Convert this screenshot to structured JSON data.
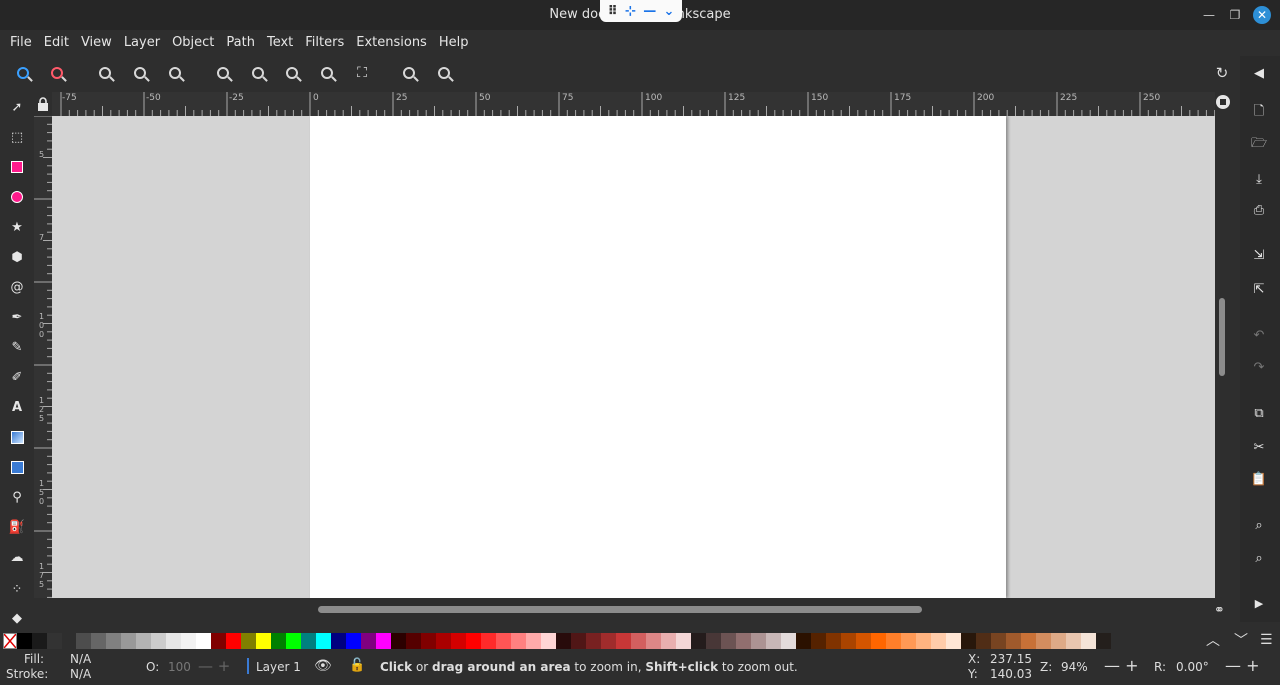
{
  "window": {
    "title": "New document 1 - Inkscape"
  },
  "menu": [
    "File",
    "Edit",
    "View",
    "Layer",
    "Object",
    "Path",
    "Text",
    "Filters",
    "Extensions",
    "Help"
  ],
  "zoombar": {
    "icons": [
      "zoom-in-icon",
      "zoom-out-icon",
      "zoom-1-1-icon",
      "zoom-1-2-icon",
      "zoom-2-1-icon",
      "zoom-selection-icon",
      "zoom-drawing-icon",
      "zoom-page-icon",
      "zoom-page-width-icon",
      "zoom-center-page-icon",
      "zoom-previous-icon",
      "zoom-next-icon"
    ]
  },
  "tools": [
    "selector-icon",
    "node-tool-icon",
    "rectangle-tool-icon",
    "ellipse-tool-icon",
    "star-tool-icon",
    "3dbox-tool-icon",
    "spiral-tool-icon",
    "pen-tool-icon",
    "pencil-tool-icon",
    "calligraphy-tool-icon",
    "text-tool-icon",
    "gradient-tool-icon",
    "mesh-tool-icon",
    "dropper-tool-icon",
    "paint-bucket-icon",
    "tweak-tool-icon",
    "spray-tool-icon",
    "eraser-tool-icon"
  ],
  "ruler": {
    "h_labels": [
      "-75",
      "-50",
      "-25",
      "0",
      "25",
      "50",
      "75",
      "100",
      "125",
      "150",
      "175",
      "200",
      "225",
      "250"
    ],
    "v_labels": [
      "5",
      "7",
      "1 0 0",
      "1 2 5",
      "1 5 0",
      "1 7 5"
    ]
  },
  "palette": {
    "colors": [
      "#000000",
      "#1a1a1a",
      "#333333",
      "#4d4d4d",
      "#666666",
      "#808080",
      "#999999",
      "#b3b3b3",
      "#cccccc",
      "#e6e6e6",
      "#f2f2f2",
      "#ffffff",
      "#800000",
      "#ff0000",
      "#808000",
      "#ffff00",
      "#008000",
      "#00ff00",
      "#008080",
      "#00ffff",
      "#000080",
      "#0000ff",
      "#800080",
      "#ff00ff",
      "#2b0000",
      "#550000",
      "#800000",
      "#aa0000",
      "#d40000",
      "#ff0000",
      "#ff2a2a",
      "#ff5555",
      "#ff8080",
      "#ffaaaa",
      "#ffd5d5",
      "#280b0b",
      "#501616",
      "#782121",
      "#a02c2c",
      "#c83737",
      "#d35f5f",
      "#de8787",
      "#e9afaf",
      "#f4d7d7",
      "#241c1c",
      "#483737",
      "#6c5353",
      "#916f6f",
      "#ac9393",
      "#c8b7b7",
      "#e3dbdb",
      "#2b1100",
      "#552200",
      "#803300",
      "#aa4400",
      "#d45500",
      "#ff6600",
      "#ff7f2a",
      "#ff9955",
      "#ffb380",
      "#ffccaa",
      "#ffe6d5",
      "#28170b",
      "#502d16",
      "#784421",
      "#a05a2c",
      "#c87137",
      "#d38d5f",
      "#deaa87",
      "#e9c6af",
      "#f4e3d7",
      "#241f1c"
    ]
  },
  "status": {
    "fill_label": "Fill:",
    "fill_value": "N/A",
    "stroke_label": "Stroke:",
    "stroke_value": "N/A",
    "opacity_label": "O:",
    "opacity_value": "100",
    "layer": "Layer 1",
    "msg_b1": "Click",
    "msg_t1": " or ",
    "msg_b2": "drag around an area",
    "msg_t2": " to zoom in, ",
    "msg_b3": "Shift+click",
    "msg_t3": " to zoom out.",
    "x_label": "X:",
    "x_value": "237.15",
    "y_label": "Y:",
    "y_value": "140.03",
    "zoom_label": "Z:",
    "zoom_value": "94%",
    "rotation_label": "R:",
    "rotation_value": "0.00°"
  }
}
